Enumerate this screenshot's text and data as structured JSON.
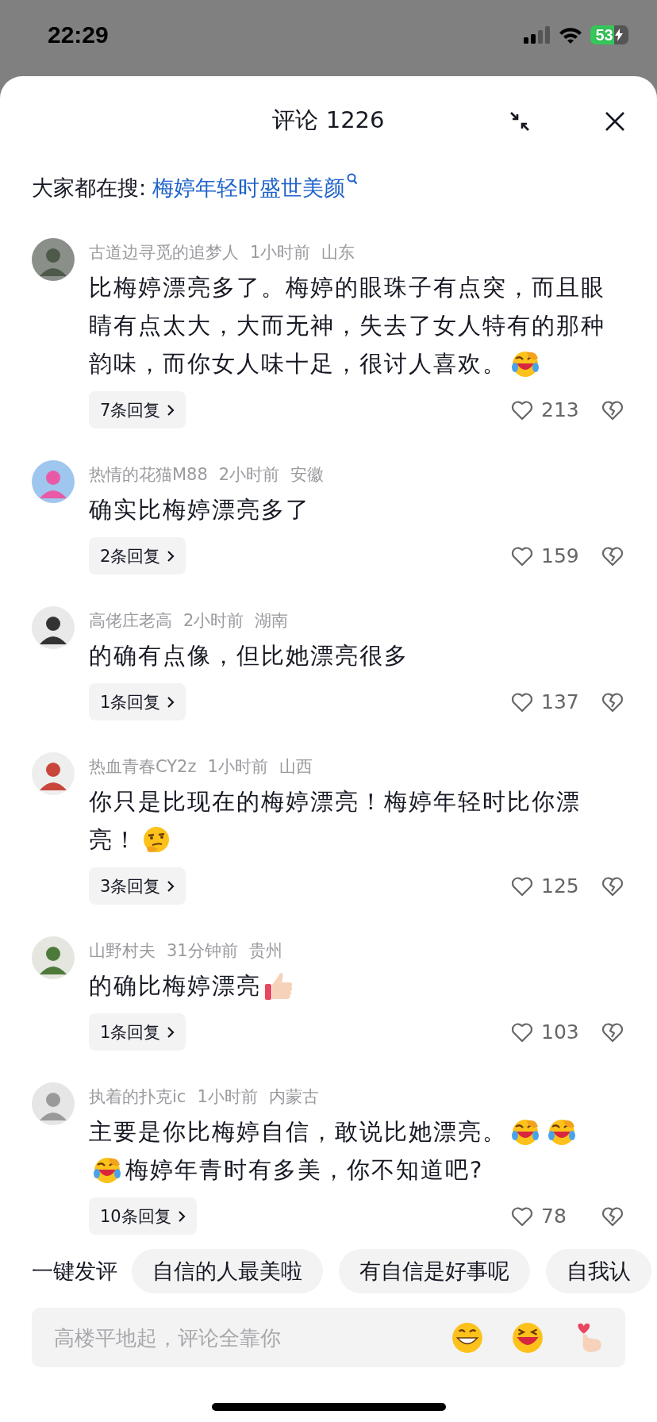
{
  "status_bar": {
    "time": "22:29",
    "battery": "53"
  },
  "header": {
    "title": "评论 1226"
  },
  "search_hint": {
    "label": "大家都在搜:",
    "query": "梅婷年轻时盛世美颜"
  },
  "comments": [
    {
      "user": "古道边寻觅的追梦人",
      "time": "1小时前",
      "location": "山东",
      "body": [
        [
          {
            "kind": "text",
            "text": "比梅婷漂亮多了。梅婷的眼珠子有点突，而且眼"
          }
        ],
        [
          {
            "kind": "text",
            "text": "睛有点太大，大而无神，失去了女人特有的那种"
          }
        ],
        [
          {
            "kind": "text",
            "text": "韵味，而你女人味十足，很讨人喜欢。"
          },
          {
            "kind": "laugh"
          }
        ]
      ],
      "replies": "7条回复",
      "likes": "213"
    },
    {
      "user": "热情的花猫M88",
      "time": "2小时前",
      "location": "安徽",
      "body": [
        [
          {
            "kind": "text",
            "text": "确实比梅婷漂亮多了"
          }
        ]
      ],
      "replies": "2条回复",
      "likes": "159"
    },
    {
      "user": "高佬庄老高",
      "time": "2小时前",
      "location": "湖南",
      "body": [
        [
          {
            "kind": "text",
            "text": "的确有点像，但比她漂亮很多"
          }
        ]
      ],
      "replies": "1条回复",
      "likes": "137"
    },
    {
      "user": "热血青春CY2z",
      "time": "1小时前",
      "location": "山西",
      "body": [
        [
          {
            "kind": "text",
            "text": "你只是比现在的梅婷漂亮！梅婷年轻时比你漂"
          }
        ],
        [
          {
            "kind": "text",
            "text": "亮！"
          },
          {
            "kind": "smirk"
          }
        ]
      ],
      "replies": "3条回复",
      "likes": "125"
    },
    {
      "user": "山野村夫",
      "time": "31分钟前",
      "location": "贵州",
      "body": [
        [
          {
            "kind": "text",
            "text": "的确比梅婷漂亮"
          },
          {
            "kind": "thumb"
          }
        ]
      ],
      "replies": "1条回复",
      "likes": "103"
    },
    {
      "user": "执着的扑克ic",
      "time": "1小时前",
      "location": "内蒙古",
      "body": [
        [
          {
            "kind": "text",
            "text": "主要是你比梅婷自信，敢说比她漂亮。"
          },
          {
            "kind": "laugh"
          },
          {
            "kind": "laugh"
          }
        ],
        [
          {
            "kind": "laugh"
          },
          {
            "kind": "text",
            "text": "梅婷年青时有多美，你不知道吧?"
          }
        ]
      ],
      "replies": "10条回复",
      "likes": "78"
    }
  ],
  "quick_comments": {
    "label": "一键发评",
    "chips": [
      "自信的人最美啦",
      "有自信是好事呢",
      "自我认"
    ]
  },
  "input": {
    "placeholder": "高楼平地起，评论全靠你",
    "emoji_buttons": [
      {
        "kind": "grin"
      },
      {
        "kind": "squint"
      },
      {
        "kind": "fingerheart"
      }
    ]
  }
}
